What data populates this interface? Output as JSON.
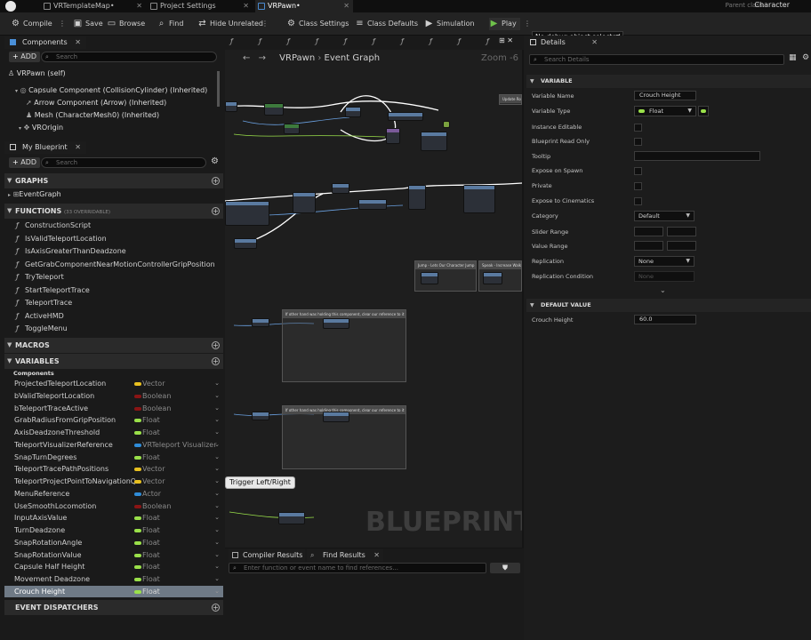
{
  "tabs": [
    {
      "label": "VRTemplateMap•"
    },
    {
      "label": "Project Settings"
    },
    {
      "label": "VRPawn•"
    }
  ],
  "parent_class": {
    "label": "Parent class:",
    "value": "Character"
  },
  "toolbar": {
    "compile": "Compile",
    "save": "Save",
    "browse": "Browse",
    "find": "Find",
    "hide_unrelated": "Hide Unrelated",
    "class_settings": "Class Settings",
    "class_defaults": "Class Defaults",
    "simulation": "Simulation",
    "play": "Play",
    "debug_object": "No debug object selected"
  },
  "components": {
    "title": "Components",
    "add": "ADD",
    "search_placeholder": "Search",
    "tree": [
      "VRPawn (self)",
      "Capsule Component (CollisionCylinder) (Inherited)",
      "Arrow Component (Arrow) (Inherited)",
      "Mesh (CharacterMesh0) (Inherited)",
      "VROrigin"
    ]
  },
  "my_blueprint": {
    "title": "My Blueprint",
    "add": "ADD",
    "search_placeholder": "Search",
    "graphs_label": "GRAPHS",
    "event_graph": "EventGraph",
    "functions_label": "FUNCTIONS",
    "functions_note": "(33 OVERRIDABLE)",
    "functions": [
      "ConstructionScript",
      "IsValidTeleportLocation",
      "IsAxisGreaterThanDeadzone",
      "GetGrabComponentNearMotionControllerGripPosition",
      "TryTeleport",
      "StartTeleportTrace",
      "TeleportTrace",
      "ActiveHMD",
      "ToggleMenu"
    ],
    "macros_label": "MACROS",
    "variables_label": "VARIABLES",
    "components_sub": "Components",
    "variables": [
      {
        "name": "ProjectedTeleportLocation",
        "type": "Vector",
        "color": "#e8c020"
      },
      {
        "name": "bValidTeleportLocation",
        "type": "Boolean",
        "color": "#8a1414"
      },
      {
        "name": "bTeleportTraceActive",
        "type": "Boolean",
        "color": "#8a1414"
      },
      {
        "name": "GrabRadiusFromGripPosition",
        "type": "Float",
        "color": "#9ae04a"
      },
      {
        "name": "AxisDeadzoneThreshold",
        "type": "Float",
        "color": "#9ae04a"
      },
      {
        "name": "TeleportVisualizerReference",
        "type": "VRTeleport Visualizer",
        "color": "#2f8cd8"
      },
      {
        "name": "SnapTurnDegrees",
        "type": "Float",
        "color": "#9ae04a"
      },
      {
        "name": "TeleportTracePathPositions",
        "type": "Vector",
        "color": "#e8c020"
      },
      {
        "name": "TeleportProjectPointToNavigationQuer",
        "type": "Vector",
        "color": "#e8c020"
      },
      {
        "name": "MenuReference",
        "type": "Actor",
        "color": "#2f8cd8"
      },
      {
        "name": "UseSmoothLocomotion",
        "type": "Boolean",
        "color": "#8a1414"
      },
      {
        "name": "InputAxisValue",
        "type": "Float",
        "color": "#9ae04a"
      },
      {
        "name": "TurnDeadzone",
        "type": "Float",
        "color": "#9ae04a"
      },
      {
        "name": "SnapRotationAngle",
        "type": "Float",
        "color": "#9ae04a"
      },
      {
        "name": "SnapRotationValue",
        "type": "Float",
        "color": "#9ae04a"
      },
      {
        "name": "Capsule Half Height",
        "type": "Float",
        "color": "#9ae04a"
      },
      {
        "name": "Movement Deadzone",
        "type": "Float",
        "color": "#9ae04a"
      },
      {
        "name": "Crouch Height",
        "type": "Float",
        "color": "#9ae04a"
      }
    ],
    "event_dispatchers_label": "EVENT DISPATCHERS"
  },
  "graph": {
    "breadcrumb_root": "VRPawn",
    "breadcrumb_current": "Event Graph",
    "zoom": "Zoom -6",
    "watermark": "BLUEPRINT",
    "tooltip": "Trigger Left/Right",
    "comment_a": "Jump - Lets Our Character Jump",
    "comment_b": "Speak - Increase Walk Speed",
    "comment_c": "If other hand was holding this component, clear our reference to it",
    "comment_d": "If other hand was holding this component, clear our reference to it",
    "comment_e": "Update Room..."
  },
  "bottom": {
    "compiler_results": "Compiler Results",
    "find_results": "Find Results",
    "find_placeholder": "Enter function or event name to find references..."
  },
  "details": {
    "title": "Details",
    "search_placeholder": "Search Details",
    "variable_section": "VARIABLE",
    "variable_name_label": "Variable Name",
    "variable_name": "Crouch Height",
    "variable_type_label": "Variable Type",
    "variable_type": "Float",
    "instance_editable": "Instance Editable",
    "blueprint_read_only": "Blueprint Read Only",
    "tooltip": "Tooltip",
    "expose_on_spawn": "Expose on Spawn",
    "private": "Private",
    "expose_to_cinematics": "Expose to Cinematics",
    "category_label": "Category",
    "category": "Default",
    "slider_range": "Slider Range",
    "value_range": "Value Range",
    "replication_label": "Replication",
    "replication": "None",
    "replication_condition": "Replication Condition",
    "replication_condition_value": "None",
    "default_value_section": "DEFAULT VALUE",
    "default_label": "Crouch Height",
    "default_value": "60.0"
  }
}
